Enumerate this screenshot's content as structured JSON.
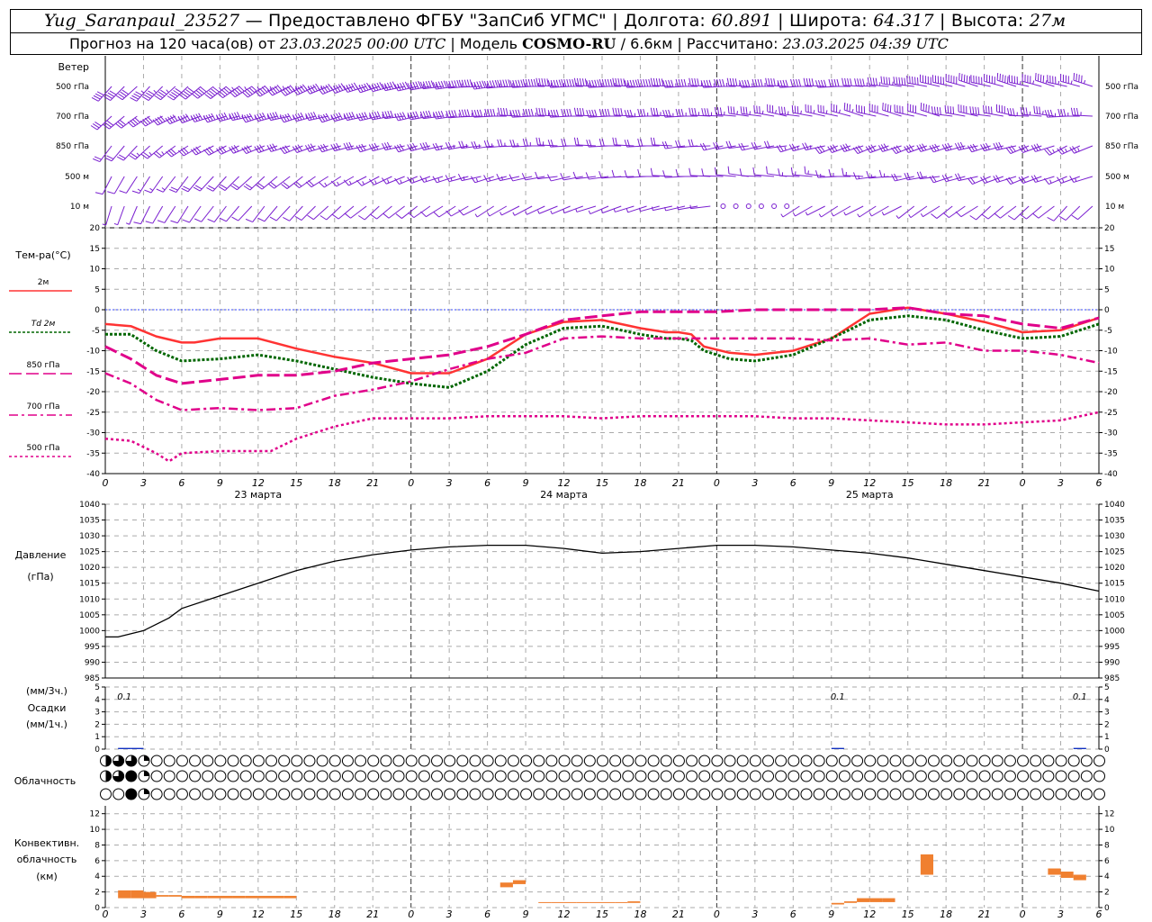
{
  "header": {
    "station": "Yug_Saranpaul_23527",
    "provider": " — Предоставлено ФГБУ \"ЗапСиб УГМС\" | Долгота: ",
    "lon": "60.891",
    "lat_label": " | Широта: ",
    "lat": "64.317",
    "alt_label": " | Высота: ",
    "alt": "27м",
    "line2_a": "Прогноз на 120 часа(ов) от ",
    "run": "23.03.2025 00:00 UTC",
    "line2_b": " | Модель ",
    "model": "COSMO-RU",
    "line2_c": " / 6.6км | Рассчитано: ",
    "calc": "23.03.2025 04:39 UTC"
  },
  "labels": {
    "wind": "Ветер",
    "wind_levels": [
      "500 гПа",
      "700 гПа",
      "850 гПа",
      "500 м",
      "10 м"
    ],
    "temp_title": "Тем-ра(°С)",
    "legend": [
      {
        "label": "2м",
        "color": "#ff3333",
        "dash": ""
      },
      {
        "label": "Td 2м",
        "color": "#006600",
        "dash": "3,2"
      },
      {
        "label": "850 гПа",
        "color": "#e0008a",
        "dash": "14,5"
      },
      {
        "label": "700 гПа",
        "color": "#e0008a",
        "dash": "10,4,3,4"
      },
      {
        "label": "500 гПа",
        "color": "#e0008a",
        "dash": "3,3"
      }
    ],
    "pressure_title": "Давление",
    "pressure_unit": "(гПа)",
    "precip_top": "(мм/3ч.)",
    "precip_mid": "Осадки",
    "precip_bot": "(мм/1ч.)",
    "cloud_title": "Облачность",
    "conv_1": "Конвективн.",
    "conv_2": "облачность",
    "conv_3": "(км)",
    "days": [
      "23 марта",
      "24 марта",
      "25 марта"
    ],
    "hour_ticks": [
      "0",
      "3",
      "6",
      "9",
      "12",
      "15",
      "18",
      "21",
      "0",
      "3",
      "6",
      "9",
      "12",
      "15",
      "18",
      "21",
      "0",
      "3",
      "6",
      "9",
      "12",
      "15",
      "18",
      "21",
      "0",
      "3",
      "6"
    ],
    "precip_notes": [
      "0.1",
      "0.1",
      "0.1"
    ]
  },
  "chart_data": {
    "type": "line",
    "x_unit": "hours from 23.03.2025 00:00 UTC",
    "xlim": [
      0,
      78
    ],
    "temperature": {
      "ylim": [
        -40,
        20
      ],
      "yticks": [
        20,
        15,
        10,
        5,
        0,
        -5,
        -10,
        -15,
        -20,
        -25,
        -30,
        -35,
        -40
      ],
      "series": [
        {
          "name": "2м",
          "color": "#ff3333",
          "x": [
            0,
            2,
            4,
            6,
            7,
            9,
            12,
            15,
            18,
            21,
            24,
            27,
            30,
            33,
            36,
            39,
            42,
            44,
            45,
            46,
            47,
            49,
            51,
            54,
            57,
            60,
            63,
            66,
            69,
            72,
            75,
            78
          ],
          "y": [
            -3.5,
            -4,
            -6.5,
            -8,
            -8,
            -7,
            -7,
            -9.5,
            -11.5,
            -13,
            -15.5,
            -15.5,
            -12,
            -6,
            -3,
            -2.5,
            -4.5,
            -5.5,
            -5.5,
            -6,
            -9,
            -10.5,
            -11,
            -10,
            -7,
            -1,
            0.5,
            -1,
            -3,
            -5.5,
            -5,
            -2
          ]
        },
        {
          "name": "Td 2м",
          "color": "#006600",
          "x": [
            0,
            2,
            4,
            6,
            9,
            12,
            15,
            18,
            21,
            24,
            27,
            30,
            33,
            36,
            39,
            42,
            44,
            45,
            46,
            47,
            49,
            51,
            54,
            57,
            60,
            63,
            66,
            69,
            72,
            75,
            78
          ],
          "y": [
            -6,
            -6,
            -10,
            -12.5,
            -12,
            -11,
            -12.5,
            -14.5,
            -16.5,
            -18,
            -19,
            -15,
            -8.5,
            -4.5,
            -4,
            -6,
            -7,
            -7,
            -7.5,
            -10,
            -12,
            -12.5,
            -11,
            -7,
            -2.5,
            -1.5,
            -2.5,
            -5,
            -7,
            -6.5,
            -3.5
          ]
        },
        {
          "name": "850 гПа",
          "color": "#e0008a",
          "x": [
            0,
            2,
            4,
            6,
            9,
            12,
            15,
            18,
            21,
            24,
            27,
            30,
            33,
            36,
            39,
            42,
            45,
            48,
            51,
            54,
            57,
            60,
            63,
            66,
            69,
            72,
            75,
            78
          ],
          "y": [
            -9,
            -12,
            -16,
            -18,
            -17,
            -16,
            -16,
            -15,
            -13,
            -12,
            -11,
            -9,
            -6,
            -2.5,
            -1.5,
            -0.5,
            -0.5,
            -0.5,
            0,
            0,
            0,
            0,
            0.5,
            -1,
            -1.5,
            -3.5,
            -4.5,
            -2
          ]
        },
        {
          "name": "700 гПа",
          "color": "#e0008a",
          "x": [
            0,
            2,
            4,
            6,
            9,
            12,
            15,
            18,
            21,
            24,
            27,
            30,
            33,
            36,
            39,
            42,
            45,
            48,
            51,
            54,
            57,
            60,
            63,
            66,
            69,
            72,
            75,
            78
          ],
          "y": [
            -15.5,
            -18,
            -22,
            -24.5,
            -24,
            -24.5,
            -24,
            -21,
            -19.5,
            -17.5,
            -14.5,
            -12,
            -10.5,
            -7,
            -6.5,
            -7,
            -7,
            -7,
            -7,
            -7,
            -7.5,
            -7,
            -8.5,
            -8,
            -10,
            -10,
            -11,
            -13
          ]
        },
        {
          "name": "500 гПа",
          "color": "#e0008a",
          "x": [
            0,
            2,
            4,
            5,
            6,
            9,
            12,
            13,
            15,
            18,
            21,
            24,
            27,
            30,
            33,
            36,
            39,
            42,
            45,
            48,
            51,
            54,
            57,
            60,
            63,
            66,
            69,
            72,
            75,
            78
          ],
          "y": [
            -31.5,
            -32,
            -35,
            -37,
            -35,
            -34.5,
            -34.5,
            -34.5,
            -31.5,
            -28.5,
            -26.5,
            -26.5,
            -26.5,
            -26,
            -26,
            -26,
            -26.5,
            -26,
            -26,
            -26,
            -26,
            -26.5,
            -26.5,
            -27,
            -27.5,
            -28,
            -28,
            -27.5,
            -27,
            -25
          ]
        }
      ]
    },
    "pressure": {
      "ylim": [
        985,
        1040
      ],
      "yticks": [
        1040,
        1035,
        1030,
        1025,
        1020,
        1015,
        1010,
        1005,
        1000,
        995,
        990,
        985
      ],
      "x": [
        0,
        1,
        3,
        5,
        6,
        9,
        12,
        15,
        18,
        21,
        24,
        27,
        30,
        33,
        36,
        39,
        42,
        45,
        48,
        51,
        54,
        57,
        60,
        63,
        66,
        69,
        72,
        75,
        78
      ],
      "y": [
        998,
        998,
        1000,
        1004,
        1007,
        1011,
        1015,
        1019,
        1022,
        1024,
        1025.5,
        1026.5,
        1027,
        1027,
        1026,
        1024.5,
        1025,
        1026,
        1027,
        1027,
        1026.5,
        1025.5,
        1024.5,
        1023,
        1021,
        1019,
        1017,
        1015,
        1012.5
      ]
    },
    "precip": {
      "ylim": [
        0,
        5
      ],
      "yticks": [
        5,
        4,
        3,
        2,
        1,
        0
      ],
      "bars": [
        [
          1,
          0.1
        ],
        [
          2,
          0.1
        ],
        [
          57,
          0.1
        ],
        [
          76,
          0.1
        ]
      ]
    },
    "wind": {
      "note": "barbs at 500 гПа, 700 гПа, 850 гПа, 500 м, 10 м",
      "levels": [
        {
          "name": "500 гПа",
          "dir": [
            225,
            225,
            230,
            235,
            240,
            245,
            250,
            255,
            260,
            265,
            265,
            270,
            270,
            270,
            270,
            270,
            270,
            270,
            270,
            270,
            275,
            280,
            285,
            285,
            285,
            285,
            280
          ],
          "speed": [
            40,
            45,
            50,
            55,
            55,
            55,
            55,
            55,
            55,
            55,
            55,
            55,
            55,
            55,
            50,
            45,
            45,
            45,
            40,
            40,
            45,
            50,
            50,
            50,
            45,
            45,
            45
          ]
        },
        {
          "name": "700 гПа",
          "dir": [
            230,
            240,
            250,
            255,
            255,
            255,
            255,
            260,
            260,
            265,
            270,
            270,
            270,
            270,
            270,
            270,
            275,
            280,
            280,
            285,
            285,
            285,
            280,
            280,
            275,
            270,
            260
          ],
          "speed": [
            30,
            40,
            45,
            45,
            45,
            45,
            45,
            45,
            45,
            45,
            45,
            45,
            40,
            40,
            35,
            35,
            35,
            35,
            35,
            35,
            40,
            40,
            40,
            40,
            35,
            35,
            35
          ]
        },
        {
          "name": "850 гПа",
          "dir": [
            220,
            230,
            240,
            245,
            250,
            250,
            255,
            255,
            255,
            260,
            265,
            270,
            270,
            270,
            270,
            265,
            260,
            260,
            255,
            250,
            250,
            250,
            255,
            255,
            250,
            245,
            240
          ],
          "speed": [
            20,
            25,
            30,
            30,
            30,
            30,
            30,
            30,
            30,
            25,
            25,
            25,
            20,
            20,
            20,
            20,
            20,
            20,
            25,
            30,
            30,
            30,
            30,
            30,
            30,
            25,
            25
          ]
        },
        {
          "name": "500 м",
          "dir": [
            210,
            215,
            220,
            225,
            230,
            235,
            240,
            245,
            250,
            255,
            255,
            260,
            260,
            265,
            270,
            270,
            275,
            275,
            275,
            270,
            265,
            260,
            255,
            250,
            250,
            250,
            245
          ],
          "speed": [
            10,
            15,
            20,
            20,
            20,
            20,
            15,
            15,
            15,
            15,
            15,
            10,
            10,
            10,
            10,
            10,
            10,
            10,
            15,
            15,
            15,
            20,
            20,
            20,
            20,
            15,
            15
          ]
        },
        {
          "name": "10 м",
          "dir": [
            200,
            210,
            215,
            220,
            220,
            225,
            230,
            230,
            235,
            240,
            240,
            245,
            250,
            250,
            255,
            260,
            250,
            245,
            240,
            240,
            240,
            235,
            235,
            230,
            230,
            225,
            225
          ],
          "speed": [
            5,
            10,
            10,
            10,
            10,
            10,
            10,
            10,
            10,
            10,
            5,
            5,
            5,
            5,
            5,
            5,
            0,
            0,
            5,
            5,
            5,
            5,
            10,
            10,
            10,
            10,
            10
          ]
        }
      ]
    },
    "cloud": {
      "rows": 3,
      "note": "octa cover per hour (0-8) for three cloud layers",
      "layer1": [
        4,
        6,
        6,
        2,
        0,
        0,
        0,
        0,
        0,
        0,
        0,
        0,
        0,
        0,
        0,
        0,
        0,
        0,
        0,
        0,
        0,
        0,
        0,
        0,
        0,
        0,
        0,
        0,
        0,
        0,
        0,
        0,
        0,
        0,
        0,
        0,
        0,
        0,
        0,
        0,
        0,
        0,
        0,
        0,
        0,
        0,
        0,
        0,
        0,
        0,
        0,
        0,
        0,
        0,
        0,
        0,
        0,
        0,
        0,
        0,
        0,
        0,
        0,
        0,
        0,
        0,
        0,
        0,
        0,
        0,
        0,
        0,
        0,
        0,
        0,
        0,
        0,
        0,
        0
      ],
      "layer2": [
        4,
        6,
        8,
        2,
        0,
        0,
        0,
        0,
        0,
        0,
        0,
        0,
        0,
        0,
        0,
        0,
        0,
        0,
        0,
        0,
        0,
        0,
        0,
        0,
        0,
        0,
        0,
        0,
        0,
        0,
        0,
        0,
        0,
        0,
        0,
        0,
        0,
        0,
        0,
        0,
        0,
        0,
        0,
        0,
        0,
        0,
        0,
        0,
        0,
        0,
        0,
        0,
        0,
        0,
        0,
        0,
        0,
        0,
        0,
        0,
        0,
        0,
        0,
        0,
        0,
        0,
        0,
        0,
        0,
        0,
        0,
        0,
        0,
        0,
        0,
        0,
        0,
        0,
        0
      ],
      "layer3": [
        0,
        0,
        8,
        2,
        0,
        0,
        0,
        0,
        0,
        0,
        0,
        0,
        0,
        0,
        0,
        0,
        0,
        0,
        0,
        0,
        0,
        0,
        0,
        0,
        0,
        0,
        0,
        0,
        0,
        0,
        0,
        0,
        0,
        0,
        0,
        0,
        0,
        0,
        0,
        0,
        0,
        0,
        0,
        0,
        0,
        0,
        0,
        0,
        0,
        0,
        0,
        0,
        0,
        0,
        0,
        0,
        0,
        0,
        0,
        0,
        0,
        0,
        0,
        0,
        0,
        0,
        0,
        0,
        0,
        0,
        0,
        0,
        0,
        0,
        0,
        0,
        0,
        0,
        0
      ]
    },
    "convective": {
      "ylim": [
        0,
        13
      ],
      "yticks": [
        12,
        10,
        8,
        6,
        4,
        2,
        0
      ],
      "bars": [
        [
          1,
          1.2,
          2.2
        ],
        [
          2,
          1.2,
          2.2
        ],
        [
          3,
          1.2,
          2.0
        ],
        [
          4,
          1.4,
          1.6
        ],
        [
          5,
          1.4,
          1.6
        ],
        [
          6,
          1.2,
          1.5
        ],
        [
          7,
          1.2,
          1.5
        ],
        [
          8,
          1.2,
          1.5
        ],
        [
          9,
          1.2,
          1.5
        ],
        [
          10,
          1.2,
          1.5
        ],
        [
          11,
          1.2,
          1.5
        ],
        [
          12,
          1.2,
          1.5
        ],
        [
          13,
          1.2,
          1.5
        ],
        [
          14,
          1.2,
          1.5
        ],
        [
          31,
          2.6,
          3.2
        ],
        [
          32,
          3.0,
          3.5
        ],
        [
          34,
          0.6,
          0.7
        ],
        [
          35,
          0.6,
          0.7
        ],
        [
          36,
          0.6,
          0.7
        ],
        [
          37,
          0.6,
          0.7
        ],
        [
          38,
          0.6,
          0.7
        ],
        [
          39,
          0.6,
          0.7
        ],
        [
          40,
          0.6,
          0.7
        ],
        [
          41,
          0.6,
          0.8
        ],
        [
          57,
          0.4,
          0.6
        ],
        [
          58,
          0.6,
          0.8
        ],
        [
          59,
          0.7,
          1.2
        ],
        [
          60,
          0.7,
          1.2
        ],
        [
          61,
          0.7,
          1.2
        ],
        [
          64,
          4.2,
          6.8
        ],
        [
          74,
          4.2,
          5.0
        ],
        [
          75,
          3.8,
          4.6
        ],
        [
          76,
          3.5,
          4.2
        ]
      ]
    }
  }
}
